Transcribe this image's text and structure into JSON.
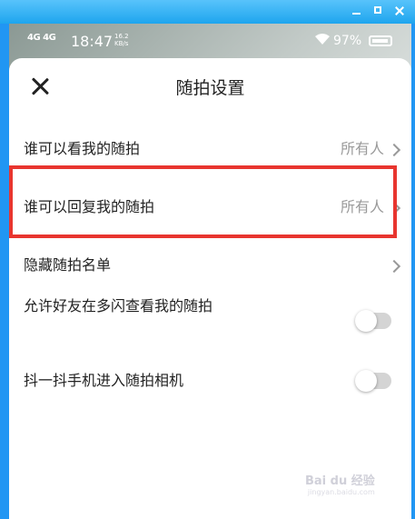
{
  "window": {
    "minimize_icon": "minimize-icon",
    "maximize_icon": "maximize-icon",
    "close_icon": "close-icon"
  },
  "statusbar": {
    "signal": "4G 4G",
    "time": "18:47",
    "speed_value": "16.2",
    "speed_unit": "KB/s",
    "battery": "97%"
  },
  "sheet": {
    "title": "随拍设置"
  },
  "settings": [
    {
      "label": "谁可以看我的随拍",
      "value": "所有人"
    },
    {
      "label": "谁可以回复我的随拍",
      "value": "所有人"
    },
    {
      "label": "隐藏随拍名单"
    },
    {
      "label": "允许好友在多闪查看我的随拍",
      "toggle": false
    },
    {
      "label": "抖一抖手机进入随拍相机",
      "toggle": false
    }
  ],
  "colors": {
    "highlight": "#e8352f",
    "titlebar": "#1ea5ee"
  },
  "watermark": {
    "text": "Bai du 经验",
    "url": "jingyan.baidu.com"
  }
}
